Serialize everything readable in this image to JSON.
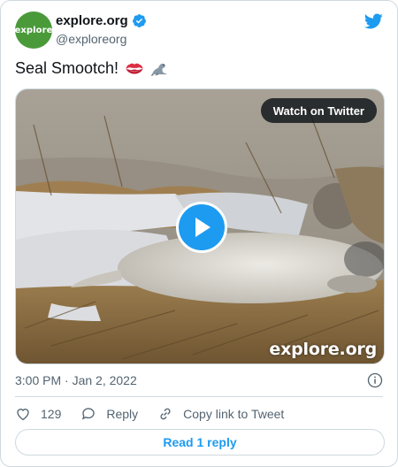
{
  "account": {
    "avatar_text": "explore",
    "display_name": "explore.org",
    "handle": "@exploreorg",
    "verified": true
  },
  "tweet": {
    "text": "Seal Smootch!",
    "emojis": [
      "kiss-lips-icon",
      "seal-icon"
    ]
  },
  "media": {
    "watch_label": "Watch on Twitter",
    "watermark": "explore.org"
  },
  "meta": {
    "timestamp": "3:00 PM · Jan 2, 2022"
  },
  "actions": {
    "like_count": "129",
    "reply_label": "Reply",
    "copy_label": "Copy link to Tweet"
  },
  "footer": {
    "read_replies_label": "Read 1 reply"
  },
  "colors": {
    "brand": "#1d9bf0",
    "secondary_text": "#536471",
    "border": "#cfd9de",
    "avatar": "#4a9a3a"
  }
}
